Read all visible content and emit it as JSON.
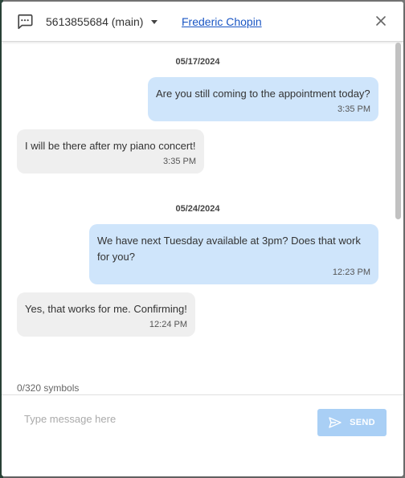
{
  "header": {
    "line_label": "5613855684 (main)",
    "contact_name": "Frederic Chopin"
  },
  "conversation": [
    {
      "date": "05/17/2024",
      "messages": [
        {
          "direction": "out",
          "text": "Are you still coming to the appointment today?",
          "time": "3:35 PM"
        },
        {
          "direction": "in",
          "text": "I will be there after my piano concert!",
          "time": "3:35 PM"
        }
      ]
    },
    {
      "date": "05/24/2024",
      "messages": [
        {
          "direction": "out",
          "text": "We have next Tuesday available at 3pm? Does that work for you?",
          "time": "12:23 PM"
        },
        {
          "direction": "in",
          "text": "Yes, that works for me. Confirming!",
          "time": "12:24 PM"
        }
      ]
    }
  ],
  "composer": {
    "counter": "0/320 symbols",
    "placeholder": "Type message here",
    "send_label": "SEND"
  },
  "colors": {
    "outgoing_bubble": "#cfe5fb",
    "incoming_bubble": "#efefef",
    "link": "#1a56c4",
    "send_button": "#a9cff5"
  }
}
